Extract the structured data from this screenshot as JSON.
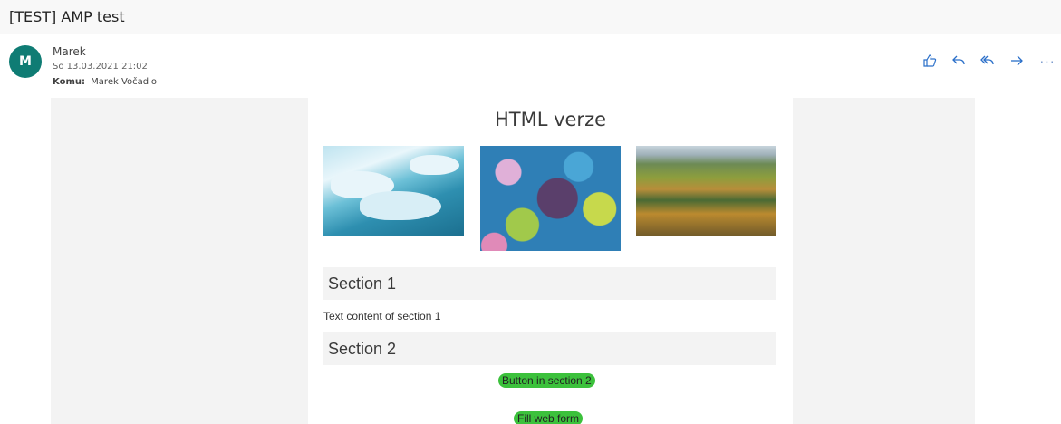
{
  "subject": "[TEST] AMP test",
  "sender": {
    "initial": "M",
    "name": "Marek",
    "date": "So 13.03.2021 21:02",
    "to_label": "Komu:",
    "to_value": "Marek Vočadlo"
  },
  "actions": [
    {
      "name": "like-icon"
    },
    {
      "name": "reply-icon"
    },
    {
      "name": "reply-all-icon"
    },
    {
      "name": "forward-icon"
    },
    {
      "name": "more-icon",
      "glyph": "···"
    }
  ],
  "colors": {
    "avatar": "#0f7c74",
    "action_icons": "#2a6fc9",
    "button_green": "#3cc13c"
  },
  "email": {
    "heading": "HTML verze",
    "images": [
      {
        "name": "ice-photo"
      },
      {
        "name": "flowers-photo"
      },
      {
        "name": "fields-photo"
      }
    ],
    "section1": {
      "title": "Section 1",
      "text": "Text content of section 1"
    },
    "section2": {
      "title": "Section 2",
      "button": "Button in section 2"
    },
    "form_button": "Fill web form"
  }
}
